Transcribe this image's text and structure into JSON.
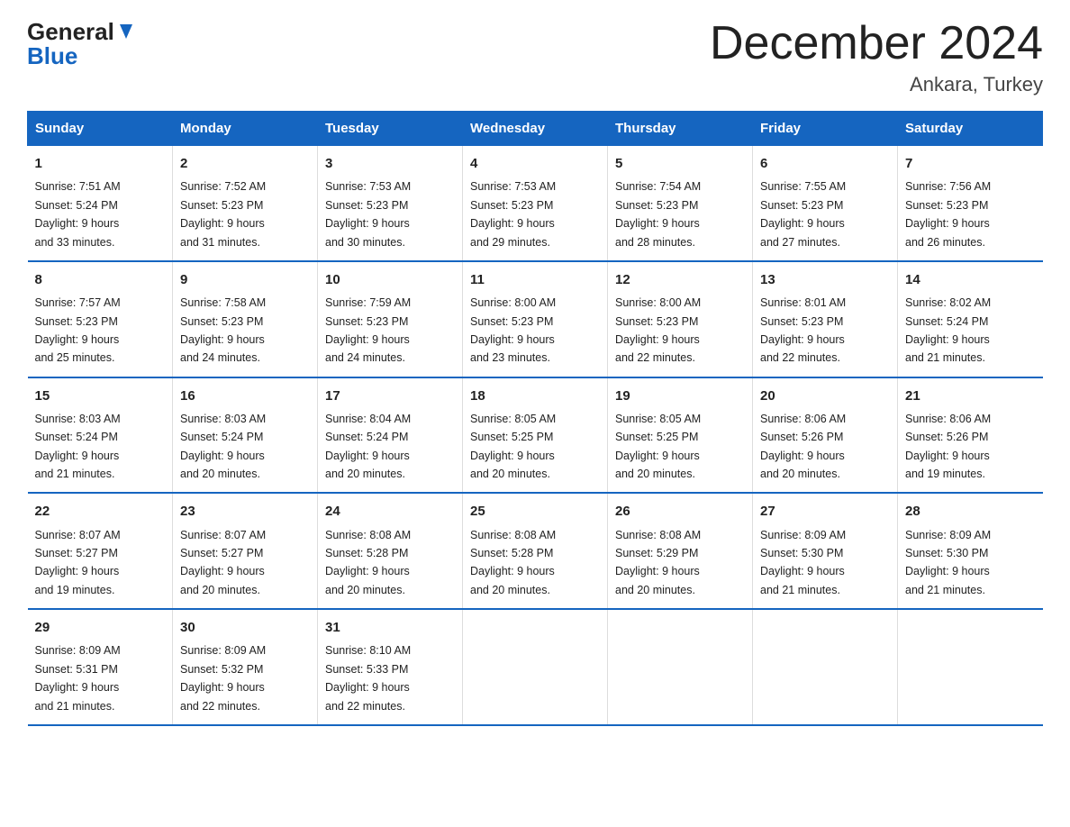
{
  "header": {
    "logo_line1": "General",
    "logo_line2": "Blue",
    "month_title": "December 2024",
    "location": "Ankara, Turkey"
  },
  "days_of_week": [
    "Sunday",
    "Monday",
    "Tuesday",
    "Wednesday",
    "Thursday",
    "Friday",
    "Saturday"
  ],
  "weeks": [
    [
      {
        "num": "1",
        "sunrise": "7:51 AM",
        "sunset": "5:24 PM",
        "daylight": "9 hours and 33 minutes."
      },
      {
        "num": "2",
        "sunrise": "7:52 AM",
        "sunset": "5:23 PM",
        "daylight": "9 hours and 31 minutes."
      },
      {
        "num": "3",
        "sunrise": "7:53 AM",
        "sunset": "5:23 PM",
        "daylight": "9 hours and 30 minutes."
      },
      {
        "num": "4",
        "sunrise": "7:53 AM",
        "sunset": "5:23 PM",
        "daylight": "9 hours and 29 minutes."
      },
      {
        "num": "5",
        "sunrise": "7:54 AM",
        "sunset": "5:23 PM",
        "daylight": "9 hours and 28 minutes."
      },
      {
        "num": "6",
        "sunrise": "7:55 AM",
        "sunset": "5:23 PM",
        "daylight": "9 hours and 27 minutes."
      },
      {
        "num": "7",
        "sunrise": "7:56 AM",
        "sunset": "5:23 PM",
        "daylight": "9 hours and 26 minutes."
      }
    ],
    [
      {
        "num": "8",
        "sunrise": "7:57 AM",
        "sunset": "5:23 PM",
        "daylight": "9 hours and 25 minutes."
      },
      {
        "num": "9",
        "sunrise": "7:58 AM",
        "sunset": "5:23 PM",
        "daylight": "9 hours and 24 minutes."
      },
      {
        "num": "10",
        "sunrise": "7:59 AM",
        "sunset": "5:23 PM",
        "daylight": "9 hours and 24 minutes."
      },
      {
        "num": "11",
        "sunrise": "8:00 AM",
        "sunset": "5:23 PM",
        "daylight": "9 hours and 23 minutes."
      },
      {
        "num": "12",
        "sunrise": "8:00 AM",
        "sunset": "5:23 PM",
        "daylight": "9 hours and 22 minutes."
      },
      {
        "num": "13",
        "sunrise": "8:01 AM",
        "sunset": "5:23 PM",
        "daylight": "9 hours and 22 minutes."
      },
      {
        "num": "14",
        "sunrise": "8:02 AM",
        "sunset": "5:24 PM",
        "daylight": "9 hours and 21 minutes."
      }
    ],
    [
      {
        "num": "15",
        "sunrise": "8:03 AM",
        "sunset": "5:24 PM",
        "daylight": "9 hours and 21 minutes."
      },
      {
        "num": "16",
        "sunrise": "8:03 AM",
        "sunset": "5:24 PM",
        "daylight": "9 hours and 20 minutes."
      },
      {
        "num": "17",
        "sunrise": "8:04 AM",
        "sunset": "5:24 PM",
        "daylight": "9 hours and 20 minutes."
      },
      {
        "num": "18",
        "sunrise": "8:05 AM",
        "sunset": "5:25 PM",
        "daylight": "9 hours and 20 minutes."
      },
      {
        "num": "19",
        "sunrise": "8:05 AM",
        "sunset": "5:25 PM",
        "daylight": "9 hours and 20 minutes."
      },
      {
        "num": "20",
        "sunrise": "8:06 AM",
        "sunset": "5:26 PM",
        "daylight": "9 hours and 20 minutes."
      },
      {
        "num": "21",
        "sunrise": "8:06 AM",
        "sunset": "5:26 PM",
        "daylight": "9 hours and 19 minutes."
      }
    ],
    [
      {
        "num": "22",
        "sunrise": "8:07 AM",
        "sunset": "5:27 PM",
        "daylight": "9 hours and 19 minutes."
      },
      {
        "num": "23",
        "sunrise": "8:07 AM",
        "sunset": "5:27 PM",
        "daylight": "9 hours and 20 minutes."
      },
      {
        "num": "24",
        "sunrise": "8:08 AM",
        "sunset": "5:28 PM",
        "daylight": "9 hours and 20 minutes."
      },
      {
        "num": "25",
        "sunrise": "8:08 AM",
        "sunset": "5:28 PM",
        "daylight": "9 hours and 20 minutes."
      },
      {
        "num": "26",
        "sunrise": "8:08 AM",
        "sunset": "5:29 PM",
        "daylight": "9 hours and 20 minutes."
      },
      {
        "num": "27",
        "sunrise": "8:09 AM",
        "sunset": "5:30 PM",
        "daylight": "9 hours and 21 minutes."
      },
      {
        "num": "28",
        "sunrise": "8:09 AM",
        "sunset": "5:30 PM",
        "daylight": "9 hours and 21 minutes."
      }
    ],
    [
      {
        "num": "29",
        "sunrise": "8:09 AM",
        "sunset": "5:31 PM",
        "daylight": "9 hours and 21 minutes."
      },
      {
        "num": "30",
        "sunrise": "8:09 AM",
        "sunset": "5:32 PM",
        "daylight": "9 hours and 22 minutes."
      },
      {
        "num": "31",
        "sunrise": "8:10 AM",
        "sunset": "5:33 PM",
        "daylight": "9 hours and 22 minutes."
      },
      null,
      null,
      null,
      null
    ]
  ],
  "labels": {
    "sunrise": "Sunrise:",
    "sunset": "Sunset:",
    "daylight": "Daylight:"
  }
}
